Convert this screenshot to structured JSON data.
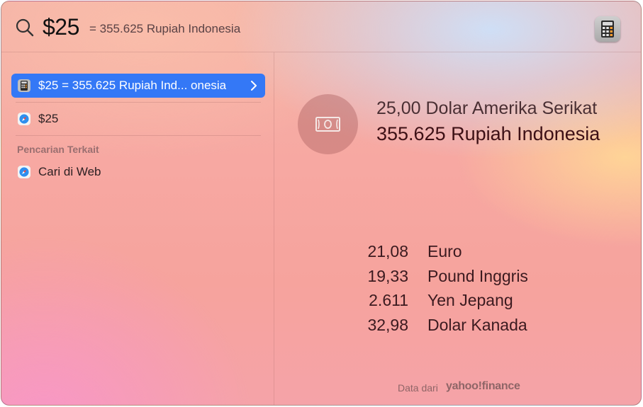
{
  "search": {
    "query": "$25",
    "inline_result": "= 355.625 Rupiah Indonesia",
    "app_icon": "calculator-icon"
  },
  "results": {
    "top_hit": {
      "label": "$25 = 355.625 Rupiah Ind... onesia",
      "icon": "calculator-icon"
    },
    "web_result": {
      "label": "$25",
      "icon": "safari-icon"
    },
    "related_section_title": "Pencarian Terkait",
    "related": [
      {
        "label": "Cari di Web",
        "icon": "safari-icon"
      }
    ]
  },
  "preview": {
    "icon": "banknote-icon",
    "from": "25,00 Dolar Amerika Serikat",
    "to": "355.625 Rupiah Indonesia",
    "rates": [
      {
        "value": "21,08",
        "currency": "Euro"
      },
      {
        "value": "19,33",
        "currency": "Pound Inggris"
      },
      {
        "value": "2.611",
        "currency": "Yen Jepang"
      },
      {
        "value": "32,98",
        "currency": "Dolar Kanada"
      }
    ],
    "attribution_prefix": "Data dari",
    "attribution_source": "yahoo!finance"
  },
  "colors": {
    "selection": "#3478f6"
  }
}
